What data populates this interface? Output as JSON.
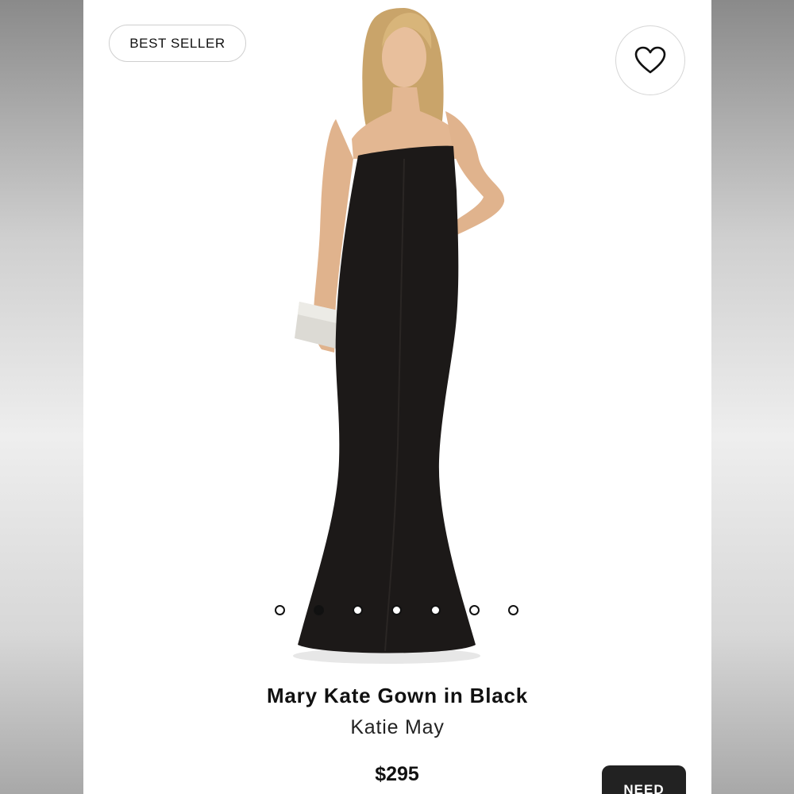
{
  "product": {
    "badge": "BEST SELLER",
    "title": "Mary Kate Gown in Black",
    "brand": "Katie May",
    "price": "$295"
  },
  "gallery": {
    "total_images": 7,
    "active_index": 1
  },
  "actions": {
    "favorite_icon": "heart-icon",
    "need_button_label": "NEED"
  },
  "colors": {
    "dress": "#1c1918",
    "accent": "#111111",
    "button_bg": "#222222"
  }
}
